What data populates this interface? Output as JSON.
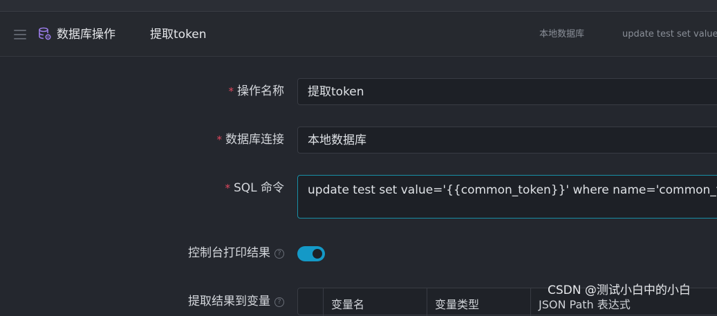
{
  "header": {
    "title": "数据库操作",
    "name": "提取token",
    "connection": "本地数据库",
    "sql_preview": "update test set value='{{common_token}}' where name='common_token'"
  },
  "form": {
    "name_label": "操作名称",
    "name_value": "提取token",
    "conn_label": "数据库连接",
    "conn_value": "本地数据库",
    "sql_label": "SQL 命令",
    "sql_value": "update test set value='{{common_token}}' where name='common_token'",
    "print_label": "控制台打印结果",
    "print_enabled": true,
    "extract_label": "提取结果到变量",
    "required_mark": "*",
    "help_mark": "?"
  },
  "table": {
    "columns": [
      "变量名",
      "变量类型",
      "JSON Path 表达式"
    ]
  },
  "watermark": "CSDN @测试小白中的小白",
  "colors": {
    "background": "#24272e",
    "accent": "#1499c7",
    "required": "#e0485e",
    "db_icon": "#9a7ce8"
  },
  "icons": {
    "menu": "hamburger-icon",
    "database": "database-gear-icon",
    "help": "question-circle-icon"
  }
}
